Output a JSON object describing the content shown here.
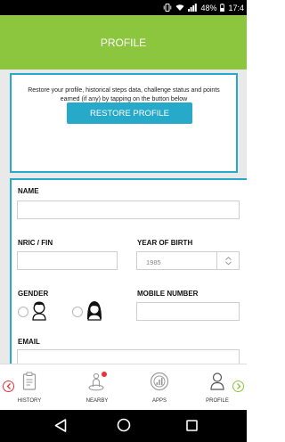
{
  "status_bar": {
    "battery": "48%",
    "time": "17:4"
  },
  "header": {
    "title": "PROFILE"
  },
  "restore": {
    "message": "Restore your profile, historical steps data, challenge status and points earned (if any) by tapping on the button below",
    "button_label": "RESTORE PROFILE"
  },
  "form": {
    "name_label": "NAME",
    "nric_label": "NRIC / FIN",
    "year_label": "YEAR OF BIRTH",
    "year_value": "1985",
    "gender_label": "GENDER",
    "mobile_label": "MOBILE NUMBER",
    "email_label": "EMAIL"
  },
  "bottom_nav": {
    "items": [
      {
        "label": "HISTORY",
        "icon": "clipboard-icon"
      },
      {
        "label": "NEARBY",
        "icon": "location-person-icon",
        "badge": true
      },
      {
        "label": "APPS",
        "icon": "apps-icon"
      },
      {
        "label": "PROFILE",
        "icon": "profile-icon"
      }
    ],
    "left_arrow_color": "#e8313a",
    "right_arrow_color": "#8cc63f"
  },
  "colors": {
    "accent_green": "#8cc63f",
    "accent_teal": "#27a9c9",
    "badge_red": "#e8313a"
  }
}
